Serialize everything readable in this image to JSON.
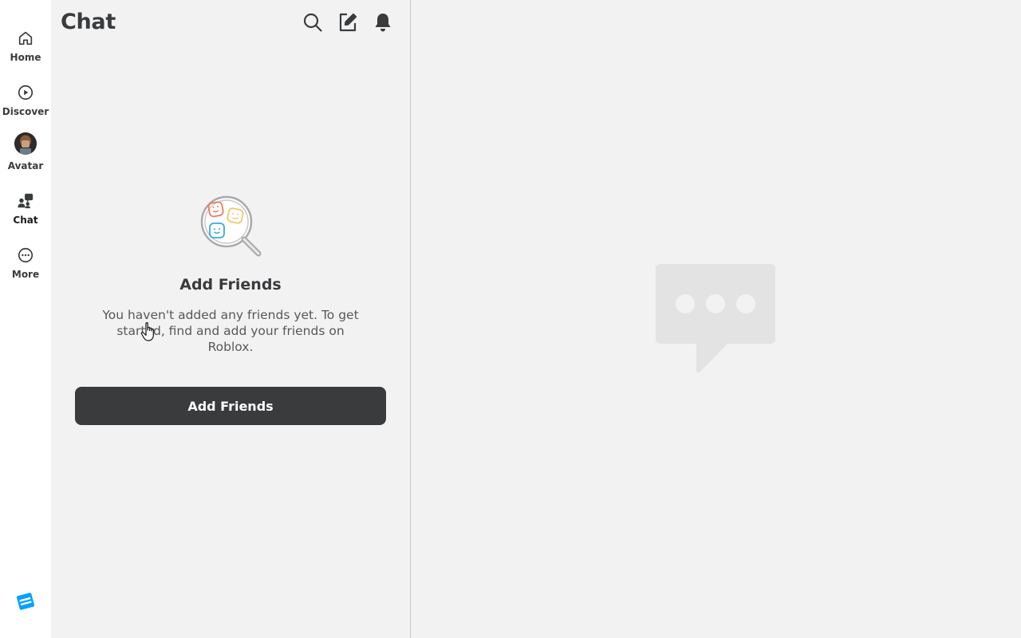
{
  "nav": {
    "items": [
      {
        "key": "home",
        "label": "Home",
        "icon": "home-icon"
      },
      {
        "key": "discover",
        "label": "Discover",
        "icon": "play-circle-icon"
      },
      {
        "key": "avatar",
        "label": "Avatar",
        "icon": "avatar-image"
      },
      {
        "key": "chat",
        "label": "Chat",
        "icon": "chat-people-icon",
        "active": true
      },
      {
        "key": "more",
        "label": "More",
        "icon": "more-icon"
      }
    ],
    "footer_icon": "roblox-studio-logo"
  },
  "chat_panel": {
    "title": "Chat",
    "header_actions": [
      {
        "key": "search",
        "icon": "search-icon"
      },
      {
        "key": "compose",
        "icon": "compose-icon"
      },
      {
        "key": "notifications",
        "icon": "bell-icon"
      }
    ],
    "empty_state": {
      "title": "Add Friends",
      "message": "You haven't added any friends yet. To get started, find and add your friends on Roblox.",
      "button_label": "Add Friends"
    }
  },
  "conversation": {
    "placeholder_icon": "chat-bubble-placeholder-icon"
  },
  "colors": {
    "background": "#f2f2f3",
    "rail": "#ffffff",
    "text": "#393b3d",
    "button": "#393b3d",
    "placeholder": "#e3e3e4",
    "accent": "#00a2ff"
  }
}
